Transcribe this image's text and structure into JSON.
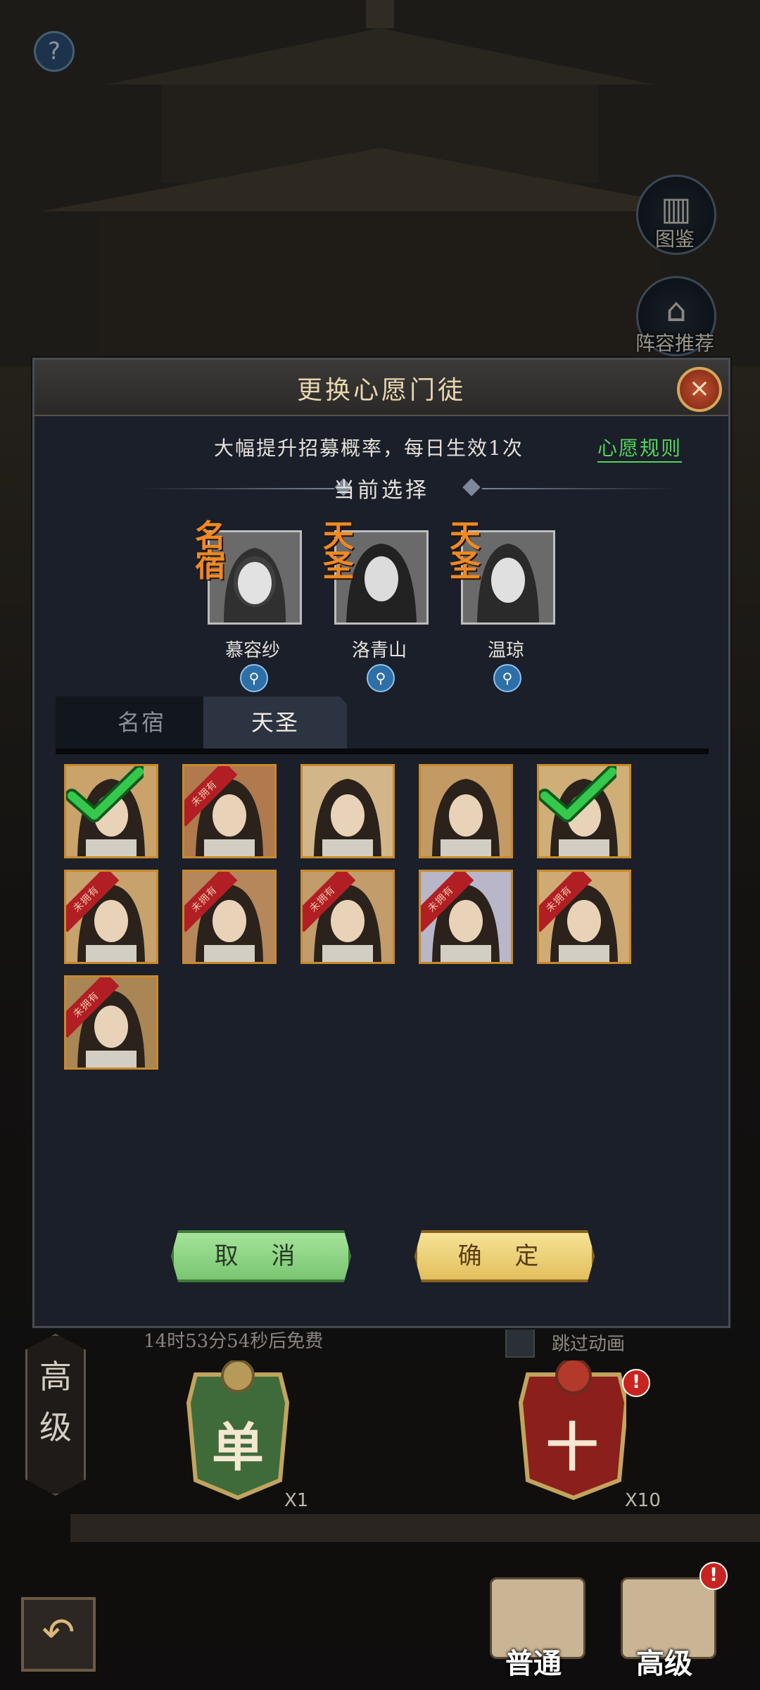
{
  "top": {
    "help_icon": "?",
    "side_buttons": [
      {
        "label": "图鉴",
        "icon": "book-icon"
      },
      {
        "label": "阵容推荐",
        "icon": "formation-icon"
      }
    ]
  },
  "dialog": {
    "title": "更换心愿门徒",
    "subtitle": "大幅提升招募概率，每日生效1次",
    "rules_link": "心愿规则",
    "section_title": "当前选择",
    "selected": [
      {
        "rank": "名宿",
        "name": "慕容纱"
      },
      {
        "rank": "天圣",
        "name": "洛青山"
      },
      {
        "rank": "天圣",
        "name": "温琼"
      }
    ],
    "tabs": [
      {
        "label": "名宿",
        "active": false
      },
      {
        "label": "天圣",
        "active": true
      }
    ],
    "grid": [
      {
        "owned": true,
        "selected": true,
        "ribbon": ""
      },
      {
        "owned": false,
        "selected": false,
        "ribbon": "未拥有"
      },
      {
        "owned": true,
        "selected": false,
        "ribbon": ""
      },
      {
        "owned": true,
        "selected": false,
        "ribbon": ""
      },
      {
        "owned": true,
        "selected": true,
        "ribbon": ""
      },
      {
        "owned": false,
        "selected": false,
        "ribbon": "未拥有"
      },
      {
        "owned": false,
        "selected": false,
        "ribbon": "未拥有"
      },
      {
        "owned": false,
        "selected": false,
        "ribbon": "未拥有"
      },
      {
        "owned": false,
        "selected": false,
        "ribbon": "未拥有"
      },
      {
        "owned": false,
        "selected": false,
        "ribbon": "未拥有"
      },
      {
        "owned": false,
        "selected": false,
        "ribbon": "未拥有"
      }
    ],
    "cancel_label": "取 消",
    "confirm_label": "确 定"
  },
  "bottom": {
    "free_timer": "14时53分54秒后免费",
    "skip_label": "跳过动画",
    "mode_label": "高级",
    "single": {
      "label": "单",
      "mult": "X1"
    },
    "ten": {
      "label": "十",
      "mult": "X10"
    },
    "tabs": [
      {
        "label": "普通"
      },
      {
        "label": "高级"
      }
    ]
  },
  "colors": {
    "accent_green": "#53d35b",
    "rank_orange": "#f08a22",
    "ribbon_red": "#b11f24",
    "frame_gold": "#c8892b"
  }
}
